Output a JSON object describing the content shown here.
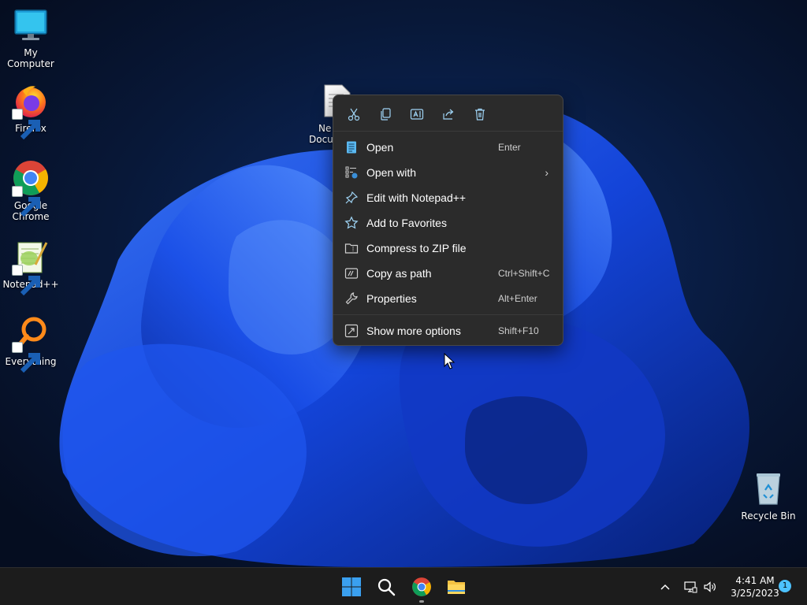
{
  "desktop": {
    "icons": [
      {
        "label": "My Computer",
        "icon": "monitor-icon"
      },
      {
        "label": "Firefox",
        "icon": "firefox-icon"
      },
      {
        "label": "Google Chrome",
        "icon": "chrome-icon"
      },
      {
        "label": "Notepad++",
        "icon": "notepadpp-icon"
      },
      {
        "label": "Everything",
        "icon": "everything-icon"
      },
      {
        "label": "Recycle Bin",
        "icon": "recycle-bin-icon"
      }
    ],
    "file_label_line1": "Ne",
    "file_label_line2": "Docu"
  },
  "context_menu": {
    "quick_actions": [
      "cut-icon",
      "copy-icon",
      "rename-icon",
      "share-icon",
      "delete-icon"
    ],
    "items": [
      {
        "label": "Open",
        "shortcut": "Enter",
        "icon": "notepad-file-icon"
      },
      {
        "label": "Open with",
        "shortcut": "",
        "icon": "open-with-icon",
        "submenu_glyph": "›"
      },
      {
        "label": "Edit with Notepad++",
        "shortcut": "",
        "icon": "pin-icon"
      },
      {
        "label": "Add to Favorites",
        "shortcut": "",
        "icon": "star-icon"
      },
      {
        "label": "Compress to ZIP file",
        "shortcut": "",
        "icon": "zip-folder-icon"
      },
      {
        "label": "Copy as path",
        "shortcut": "Ctrl+Shift+C",
        "icon": "copy-path-icon"
      },
      {
        "label": "Properties",
        "shortcut": "Alt+Enter",
        "icon": "wrench-icon"
      }
    ],
    "more_options": {
      "label": "Show more options",
      "shortcut": "Shift+F10",
      "icon": "more-options-icon"
    }
  },
  "taskbar": {
    "pinned": [
      "start-icon",
      "search-icon",
      "chrome-icon",
      "file-explorer-icon"
    ],
    "tray_chevron": "^",
    "time": "4:41 AM",
    "date": "3/25/2023",
    "notification_count": "1"
  },
  "colors": {
    "accent": "#4cc2ff",
    "menu_bg": "#2b2b2b",
    "taskbar_bg": "#1c1c1c"
  }
}
